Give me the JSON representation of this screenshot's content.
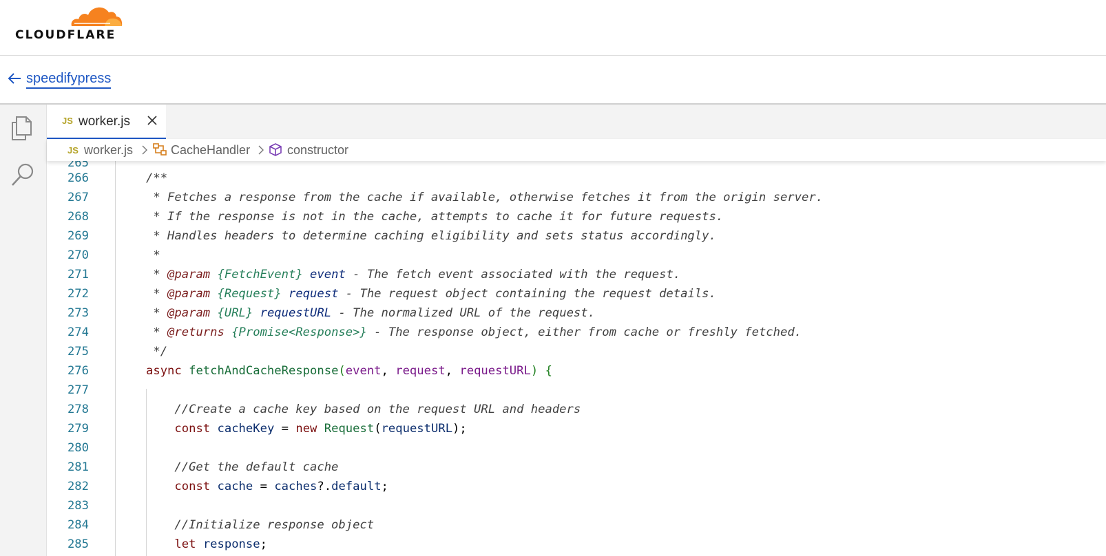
{
  "header": {
    "logo_text": "CLOUDFLARE",
    "brand_color": "#f6821f"
  },
  "back": {
    "label": "speedifypress"
  },
  "activity": {
    "icons": [
      "explorer-icon",
      "search-icon"
    ]
  },
  "tab": {
    "badge": "JS",
    "filename": "worker.js"
  },
  "breadcrumb": {
    "badge": "JS",
    "file": "worker.js",
    "class": "CacheHandler",
    "member": "constructor"
  },
  "editor": {
    "lines": [
      {
        "n": "265",
        "t": ""
      },
      {
        "n": "266",
        "t": "/**"
      },
      {
        "n": "267",
        "t": " * Fetches a response from the cache if available, otherwise fetches it from the origin server."
      },
      {
        "n": "268",
        "t": " * If the response is not in the cache, attempts to cache it for future requests."
      },
      {
        "n": "269",
        "t": " * Handles headers to determine caching eligibility and sets status accordingly."
      },
      {
        "n": "270",
        "t": " *"
      },
      {
        "n": "271",
        "t": " * @param {FetchEvent} event - The fetch event associated with the request."
      },
      {
        "n": "272",
        "t": " * @param {Request} request - The request object containing the request details."
      },
      {
        "n": "273",
        "t": " * @param {URL} requestURL - The normalized URL of the request."
      },
      {
        "n": "274",
        "t": " * @returns {Promise<Response>} - The response object, either from cache or freshly fetched."
      },
      {
        "n": "275",
        "t": " */"
      },
      {
        "n": "276",
        "t": "async fetchAndCacheResponse(event, request, requestURL) {"
      },
      {
        "n": "277",
        "t": ""
      },
      {
        "n": "278",
        "t": "    //Create a cache key based on the request URL and headers"
      },
      {
        "n": "279",
        "t": "    const cacheKey = new Request(requestURL);"
      },
      {
        "n": "280",
        "t": ""
      },
      {
        "n": "281",
        "t": "    //Get the default cache"
      },
      {
        "n": "282",
        "t": "    const cache = caches?.default;"
      },
      {
        "n": "283",
        "t": ""
      },
      {
        "n": "284",
        "t": "    //Initialize response object"
      },
      {
        "n": "285",
        "t": "    let response;"
      }
    ]
  }
}
